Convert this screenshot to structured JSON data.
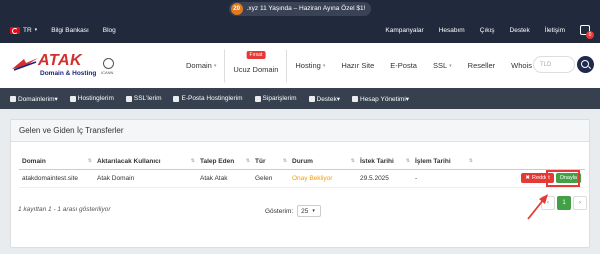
{
  "announcement": {
    "badge": "20",
    "text": ".xyz 11 Yaşında – Haziran Ayına Özel $1!"
  },
  "topbar": {
    "language": "TR",
    "links_left": [
      "Bilgi Bankası",
      "Blog"
    ],
    "links_right": [
      "Kampanyalar",
      "Hesabım",
      "Çıkış",
      "Destek",
      "İletişim"
    ],
    "cart_count": "0"
  },
  "logo": {
    "name": "ATAK",
    "tagline": "Domain & Hosting",
    "registrar": "ICANN"
  },
  "mainnav": {
    "items": [
      {
        "label": "Domain"
      },
      {
        "label": "Ucuz Domain",
        "badge": "Fırsat"
      },
      {
        "label": "Hosting"
      },
      {
        "label": "Hazır Site"
      },
      {
        "label": "E-Posta"
      },
      {
        "label": "SSL"
      },
      {
        "label": "Reseller"
      },
      {
        "label": "Whois"
      }
    ],
    "search_placeholder": "TLD"
  },
  "clientnav": {
    "items": [
      "Domainlerim▾",
      "Hostinglerim",
      "SSL'lerim",
      "E-Posta Hostinglerim",
      "Siparişlerim",
      "Destek▾",
      "Hesap Yönetimi▾"
    ]
  },
  "panel": {
    "title": "Gelen ve Giden İç Transferler",
    "columns": [
      "Domain",
      "Aktarılacak Kullanıcı",
      "Talep Eden",
      "Tür",
      "Durum",
      "İstek Tarihi",
      "İşlem Tarihi",
      ""
    ],
    "rows": [
      {
        "domain": "atakdomaintest.site",
        "target_user": "Atak Domain",
        "requested_by": "Atak Atak",
        "type": "Gelen",
        "status": "Onay Bekliyor",
        "request_date": "29.5.2025",
        "process_date": "-",
        "reject_label": "Reddet",
        "approve_label": "Onayla"
      }
    ],
    "info": "1 kayıttan 1 - 1 arası gösteriliyor",
    "length_label": "Gösterim:",
    "length_value": "25",
    "pager": {
      "prev": "‹",
      "current": "1",
      "next": "›"
    }
  },
  "colors": {
    "topbar": "#212a3d",
    "clientnav": "#36404f",
    "approve": "#43a047",
    "reject": "#e53935",
    "status_pending": "#f39c12",
    "brand_red": "#d32f2f"
  }
}
